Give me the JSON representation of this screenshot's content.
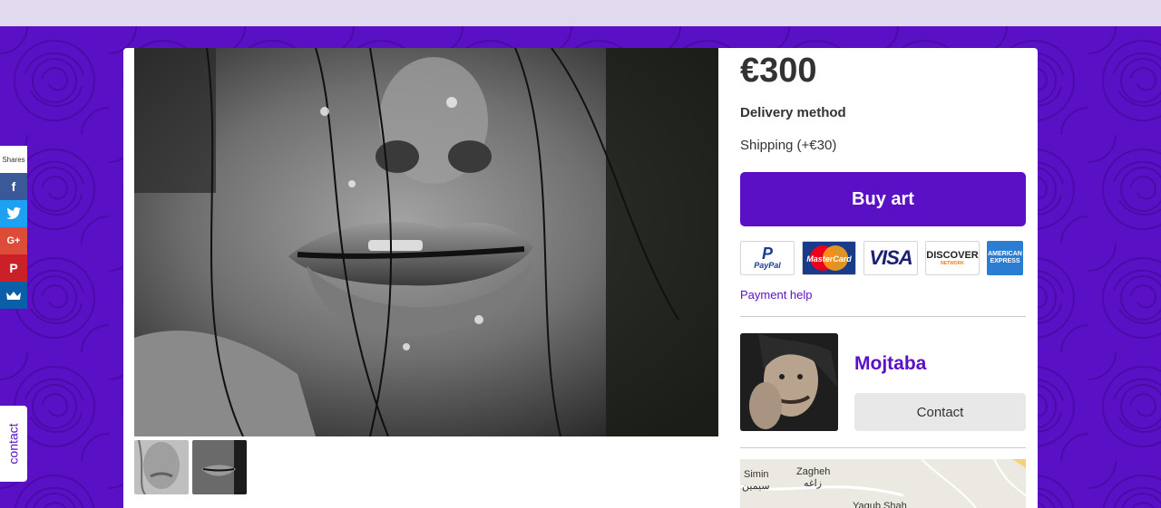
{
  "product": {
    "price": "€300",
    "delivery_label": "Delivery method",
    "shipping": "Shipping (+€30)",
    "buy_label": "Buy art",
    "payment_help": "Payment help"
  },
  "payment_cards": [
    {
      "name": "PayPal",
      "top": "P",
      "sub": "PayPal"
    },
    {
      "name": "MasterCard",
      "label": "MasterCard"
    },
    {
      "name": "VISA",
      "label": "VISA"
    },
    {
      "name": "DISCOVER",
      "label": "DISCOVER",
      "sub": "NETWORK"
    },
    {
      "name": "AMERICAN EXPRESS",
      "line1": "AMERICAN",
      "line2": "EXPRESS"
    }
  ],
  "artist": {
    "name": "Mojtaba",
    "contact_label": "Contact"
  },
  "map": {
    "labels": [
      "Simin",
      "سیمین",
      "Zagheh",
      "زاغه",
      "Yaqub Shah"
    ]
  },
  "share": {
    "label": "Shares",
    "buttons": [
      {
        "network": "facebook",
        "glyph": "f",
        "color": "#3b5998"
      },
      {
        "network": "twitter",
        "glyph": "t",
        "color": "#1da1f2"
      },
      {
        "network": "google-plus",
        "glyph": "G+",
        "color": "#dd4b39"
      },
      {
        "network": "pinterest",
        "glyph": "P",
        "color": "#cb2027"
      },
      {
        "network": "sumome",
        "glyph": "~",
        "color": "#0a5fa8"
      }
    ]
  },
  "contact_tab": "contact"
}
